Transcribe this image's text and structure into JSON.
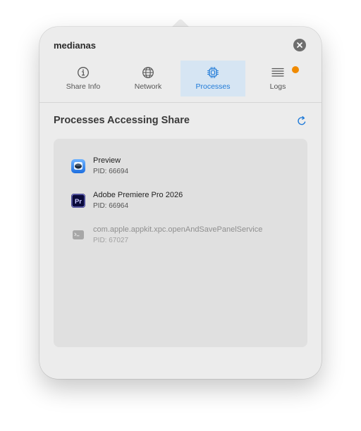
{
  "window": {
    "title": "medianas"
  },
  "tabs": [
    {
      "label": "Share Info",
      "icon": "info-circle-icon",
      "selected": false
    },
    {
      "label": "Network",
      "icon": "globe-icon",
      "selected": false
    },
    {
      "label": "Processes",
      "icon": "cpu-chip-icon",
      "selected": true
    },
    {
      "label": "Logs",
      "icon": "list-lines-icon",
      "selected": false,
      "badge_color": "#f08a00"
    }
  ],
  "section": {
    "title": "Processes Accessing Share"
  },
  "processes": [
    {
      "name": "Preview",
      "pid_text": "PID: 66694",
      "icon": "preview-app-icon",
      "dimmed": false
    },
    {
      "name": "Adobe Premiere Pro 2026",
      "pid_text": "PID: 66964",
      "icon": "premiere-pro-app-icon",
      "icon_text": "Pr",
      "dimmed": false
    },
    {
      "name": "com.apple.appkit.xpc.openAndSavePanelService",
      "pid_text": "PID: 67027",
      "icon": "terminal-app-icon",
      "dimmed": true
    }
  ],
  "colors": {
    "accent": "#1f7ad8",
    "selected_tab_bg": "#d6e5f3",
    "badge": "#f08a00"
  }
}
